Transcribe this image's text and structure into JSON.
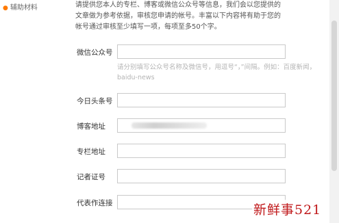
{
  "side_label": "辅助材料",
  "intro": {
    "line1": "请提供您本人的专栏、博客或微信公众号等信息，我们会以您提供的",
    "line2": "文章做为参考依据，审核您申请的帐号。丰富以下内容将有助于您的",
    "line3a": "帐号通过审核",
    "line3b": "至少填写一项，每项至多50个字。"
  },
  "fields": [
    {
      "label": "微信公众号",
      "value": ""
    },
    {
      "label": "今日头条号",
      "value": ""
    },
    {
      "label": "博客地址",
      "value": ""
    },
    {
      "label": "专栏地址",
      "value": ""
    },
    {
      "label": "记者证号",
      "value": ""
    },
    {
      "label": "代表作连接",
      "value": ""
    }
  ],
  "hint": "请分别填写公众号名称及微信号，用逗号“，”间隔。例如：百度新闻，baidu-news",
  "watermark": "新鲜事521"
}
